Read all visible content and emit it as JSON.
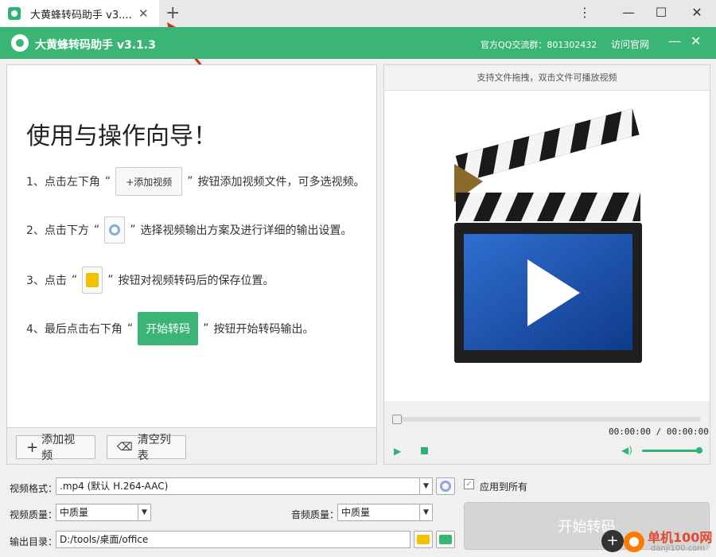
{
  "browser": {
    "tab_title": "大黄蜂转码助手 v3....",
    "tab_close": "✕",
    "new_tab": "+",
    "menu": "⋮",
    "minimize": "—",
    "maximize": "☐",
    "close": "✕"
  },
  "app": {
    "title": "大黄蜂转码助手 v3.1.3",
    "qq_group": "官方QQ交流群：801302432",
    "visit_site": "访问官网",
    "minimize": "—",
    "close": "✕",
    "accent": "#3bb575"
  },
  "guide": {
    "title": "使用与操作向导！",
    "steps": [
      {
        "prefix": "1、点击左下角",
        "open": "“",
        "button": "+添加视频",
        "close": "”",
        "suffix": "按钮添加视频文件，可多选视频。"
      },
      {
        "prefix": "2、点击下方",
        "open": "“",
        "close": "”",
        "suffix": "选择视频输出方案及进行详细的输出设置。"
      },
      {
        "prefix": "3、点击",
        "open": "“",
        "close": "”",
        "suffix": "按钮对视频转码后的保存位置。"
      },
      {
        "prefix": "4、最后点击右下角",
        "open": "“",
        "button": "开始转码",
        "close": "”",
        "suffix": "按钮开始转码输出。"
      }
    ]
  },
  "list_actions": {
    "add_video": "添加视频",
    "add_icon": "+",
    "clear_list": "清空列表",
    "clear_icon": "⌫"
  },
  "preview": {
    "hint": "支持文件拖拽，双击文件可播放视频",
    "time": "00:00:00 / 00:00:00",
    "progress": 0,
    "volume": 1.0,
    "play_icon": "▶",
    "volume_icon": "◀)"
  },
  "settings": {
    "format_label": "视频格式：",
    "format_value": ".mp4 (默认 H.264-AAC)",
    "apply_all_label": "应用到所有",
    "apply_all_checked": true,
    "check_mark": "✓",
    "video_quality_label": "视频质量：",
    "video_quality_value": "中质量",
    "audio_quality_label": "音频质量：",
    "audio_quality_value": "中质量",
    "output_label": "输出目录：",
    "output_value": "D:/tools/桌面/office",
    "arrow": "▼",
    "start_button": "开始转码"
  },
  "watermark": {
    "plus": "+",
    "text": "单机100网",
    "url": "danji100.com"
  }
}
